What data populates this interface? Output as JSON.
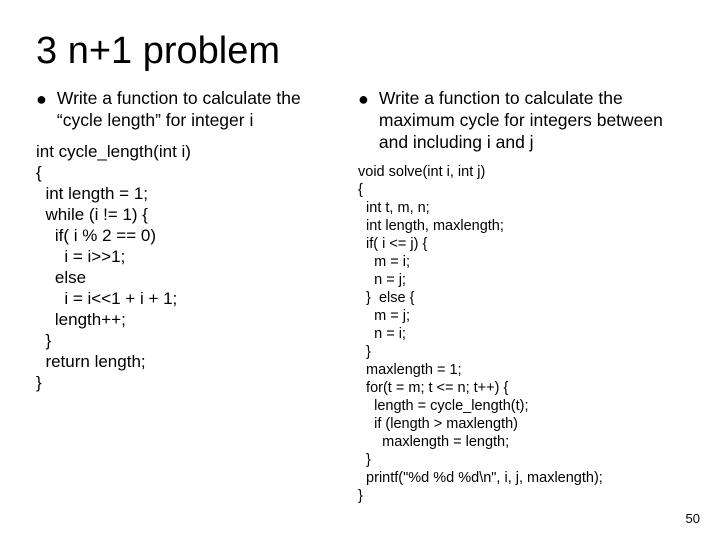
{
  "title": "3 n+1 problem",
  "left": {
    "bullet": "Write a function to calculate the “cycle length” for integer i",
    "code": "int cycle_length(int i)\n{\n  int length = 1;\n  while (i != 1) {\n    if( i % 2 == 0)\n      i = i>>1;\n    else\n      i = i<<1 + i + 1;\n    length++;\n  }\n  return length;\n}"
  },
  "right": {
    "bullet": "Write a function to calculate the maximum cycle for integers between and including i and j",
    "code": "void solve(int i, int j)\n{\n  int t, m, n;\n  int length, maxlength;\n  if( i <= j) {\n    m = i;\n    n = j;\n  }  else {\n    m = j;\n    n = i;\n  }\n  maxlength = 1;\n  for(t = m; t <= n; t++) {\n    length = cycle_length(t);\n    if (length > maxlength)\n      maxlength = length;\n  }\n  printf(\"%d %d %d\\n\", i, j, maxlength);\n}"
  },
  "page_number": "50"
}
